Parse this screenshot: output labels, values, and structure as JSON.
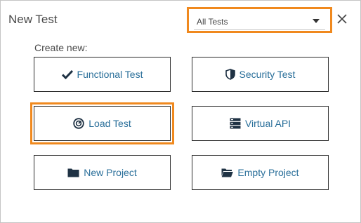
{
  "dialog": {
    "title": "New Test",
    "close_icon": "close-icon"
  },
  "filter": {
    "selected": "All Tests",
    "icon": "chevron-down-icon"
  },
  "main": {
    "subtitle": "Create new:",
    "options": [
      {
        "label": "Functional Test",
        "icon": "checkmark-icon"
      },
      {
        "label": "Security Test",
        "icon": "shield-icon"
      },
      {
        "label": "Load Test",
        "icon": "gauge-icon"
      },
      {
        "label": "Virtual API",
        "icon": "server-icon"
      },
      {
        "label": "New Project",
        "icon": "folder-icon"
      },
      {
        "label": "Empty Project",
        "icon": "folder-open-icon"
      }
    ]
  },
  "colors": {
    "accent": "#f0891e",
    "link": "#2a6f9a",
    "icon": "#1f3244"
  }
}
